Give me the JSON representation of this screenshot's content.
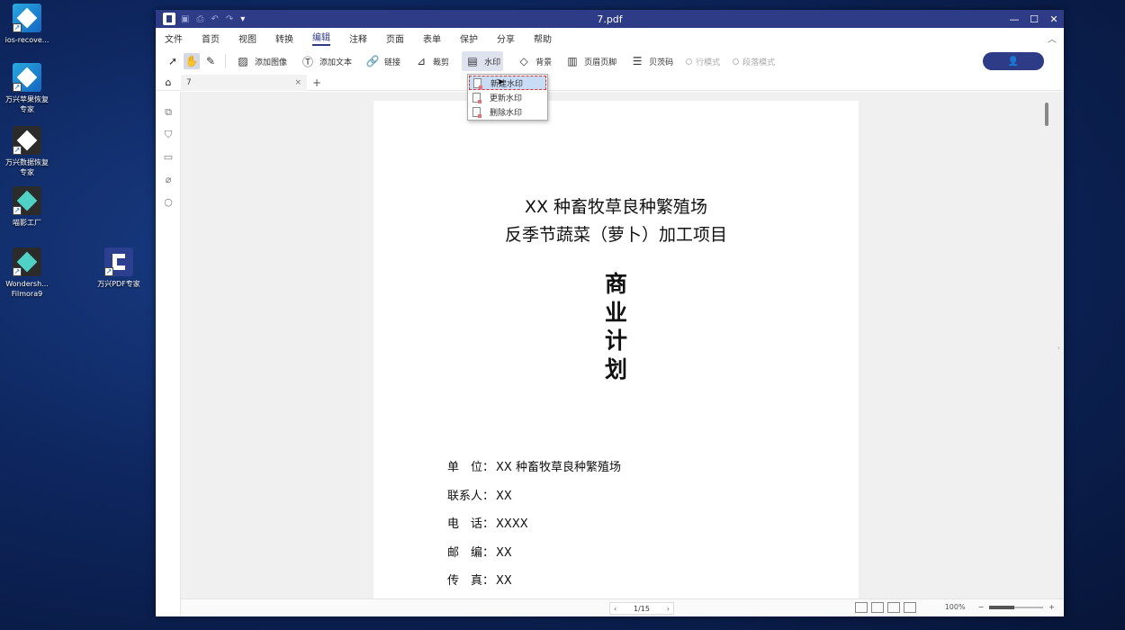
{
  "desktop": {
    "icons": [
      {
        "label": "ios-recove..."
      },
      {
        "label": "万兴苹果恢复\n专家"
      },
      {
        "label": "万兴数据恢复\n专家"
      },
      {
        "label": "喵影工厂"
      },
      {
        "label": "Wondersh...\nFilmora9"
      },
      {
        "label": "万兴PDF专家"
      }
    ]
  },
  "window": {
    "title": "7.pdf",
    "controls": {
      "minimize": "—",
      "maximize": "☐",
      "close": "✕"
    }
  },
  "menu": {
    "items": [
      "文件",
      "首页",
      "视图",
      "转换",
      "编辑",
      "注释",
      "页面",
      "表单",
      "保护",
      "分享",
      "帮助"
    ],
    "active": "编辑",
    "collapse": "︿"
  },
  "toolbar": {
    "add_image": "添加图像",
    "add_text": "添加文本",
    "link": "链接",
    "crop": "裁剪",
    "watermark": "水印",
    "background": "背景",
    "header_footer": "页眉页脚",
    "bates": "贝茨码",
    "line_mode": "行模式",
    "paragraph_mode": "段落模式",
    "user_icon": "person-icon"
  },
  "watermark_menu": {
    "items": [
      "新建水印",
      "更新水印",
      "删除水印"
    ],
    "highlighted": 0
  },
  "tabs": {
    "items": [
      {
        "label": "7"
      }
    ],
    "close": "×",
    "add": "+"
  },
  "document": {
    "title_line1": "XX 种畜牧草良种繁殖场",
    "title_line2": "反季节蔬菜（萝卜）加工项目",
    "vertical_title": [
      "商",
      "业",
      "计",
      "划"
    ],
    "info": [
      {
        "key": "单　位：",
        "value": "XX 种畜牧草良种繁殖场"
      },
      {
        "key": "联系人：",
        "value": "XX"
      },
      {
        "key": "电　话：",
        "value": "XXXX"
      },
      {
        "key": "邮　编：",
        "value": "XX"
      },
      {
        "key": "传　真：",
        "value": "XX"
      }
    ]
  },
  "status": {
    "page_current": "1",
    "page_total": "/15",
    "zoom": "100%"
  }
}
